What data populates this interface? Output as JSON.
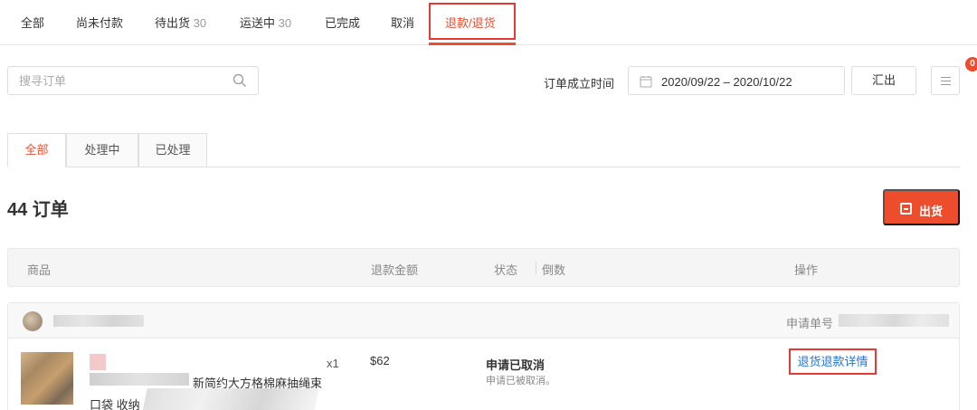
{
  "top_tabs": [
    {
      "label": "全部",
      "count": ""
    },
    {
      "label": "尚未付款",
      "count": ""
    },
    {
      "label": "待出货",
      "count": "30"
    },
    {
      "label": "运送中",
      "count": "30"
    },
    {
      "label": "已完成",
      "count": ""
    },
    {
      "label": "取消",
      "count": ""
    },
    {
      "label": "退款/退货",
      "count": "",
      "active": true
    }
  ],
  "search": {
    "placeholder": "搜寻订单"
  },
  "date_filter": {
    "label": "订单成立时间",
    "value": "2020/09/22 – 2020/10/22"
  },
  "export_label": "汇出",
  "notification_count": "0",
  "sub_tabs": [
    {
      "label": "全部",
      "active": true
    },
    {
      "label": "处理中"
    },
    {
      "label": "已处理"
    }
  ],
  "order_count_text": "44 订单",
  "ship_button_label": "出货",
  "table_headers": {
    "product": "商品",
    "refund_amount": "退款金额",
    "status": "状态",
    "countdown": "倒数",
    "actions": "操作"
  },
  "order": {
    "request_label": "申请单号",
    "product_name_line1": "新简约大方格棉麻抽绳束",
    "product_name_line2": "口袋 收纳",
    "quantity": "x1",
    "amount": "$62",
    "status": "申请已取消",
    "status_detail": "申请已被取消。",
    "detail_link": "退货退款详情"
  },
  "colors": {
    "accent": "#ee4d2d",
    "link": "#2673dd",
    "highlight_box": "#e53935"
  }
}
